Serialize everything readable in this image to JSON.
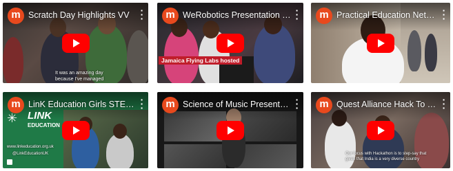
{
  "videos": [
    {
      "channel_initial": "m",
      "title": "Scratch Day Highlights VV",
      "caption": "It was an amazing day\nbecause I've managed"
    },
    {
      "channel_initial": "m",
      "title": "WeRobotics Presentation Te...",
      "banner": "Jamaica Flying Labs hosted"
    },
    {
      "channel_initial": "m",
      "title": "Practical Education Networ..."
    },
    {
      "channel_initial": "m",
      "title": "LinK Education Girls STEM ...",
      "logo_text_1": "LINK",
      "logo_text_2": "EDUCATION",
      "footer_1": "www.linkeducation.org.uk",
      "footer_2": "@LinkEducationUK"
    },
    {
      "channel_initial": "m",
      "title": "Science of Music Presentati..."
    },
    {
      "channel_initial": "m",
      "title": "Quest Alliance Hack To The ...",
      "caption": "Our focus with Hackathon is to step-say that\ngiven that India is a very diverse country"
    }
  ],
  "icons": {
    "play": "play-button-icon",
    "more": "more-vert-icon"
  },
  "colors": {
    "avatar": "#e8491d",
    "play": "#ff0000"
  }
}
